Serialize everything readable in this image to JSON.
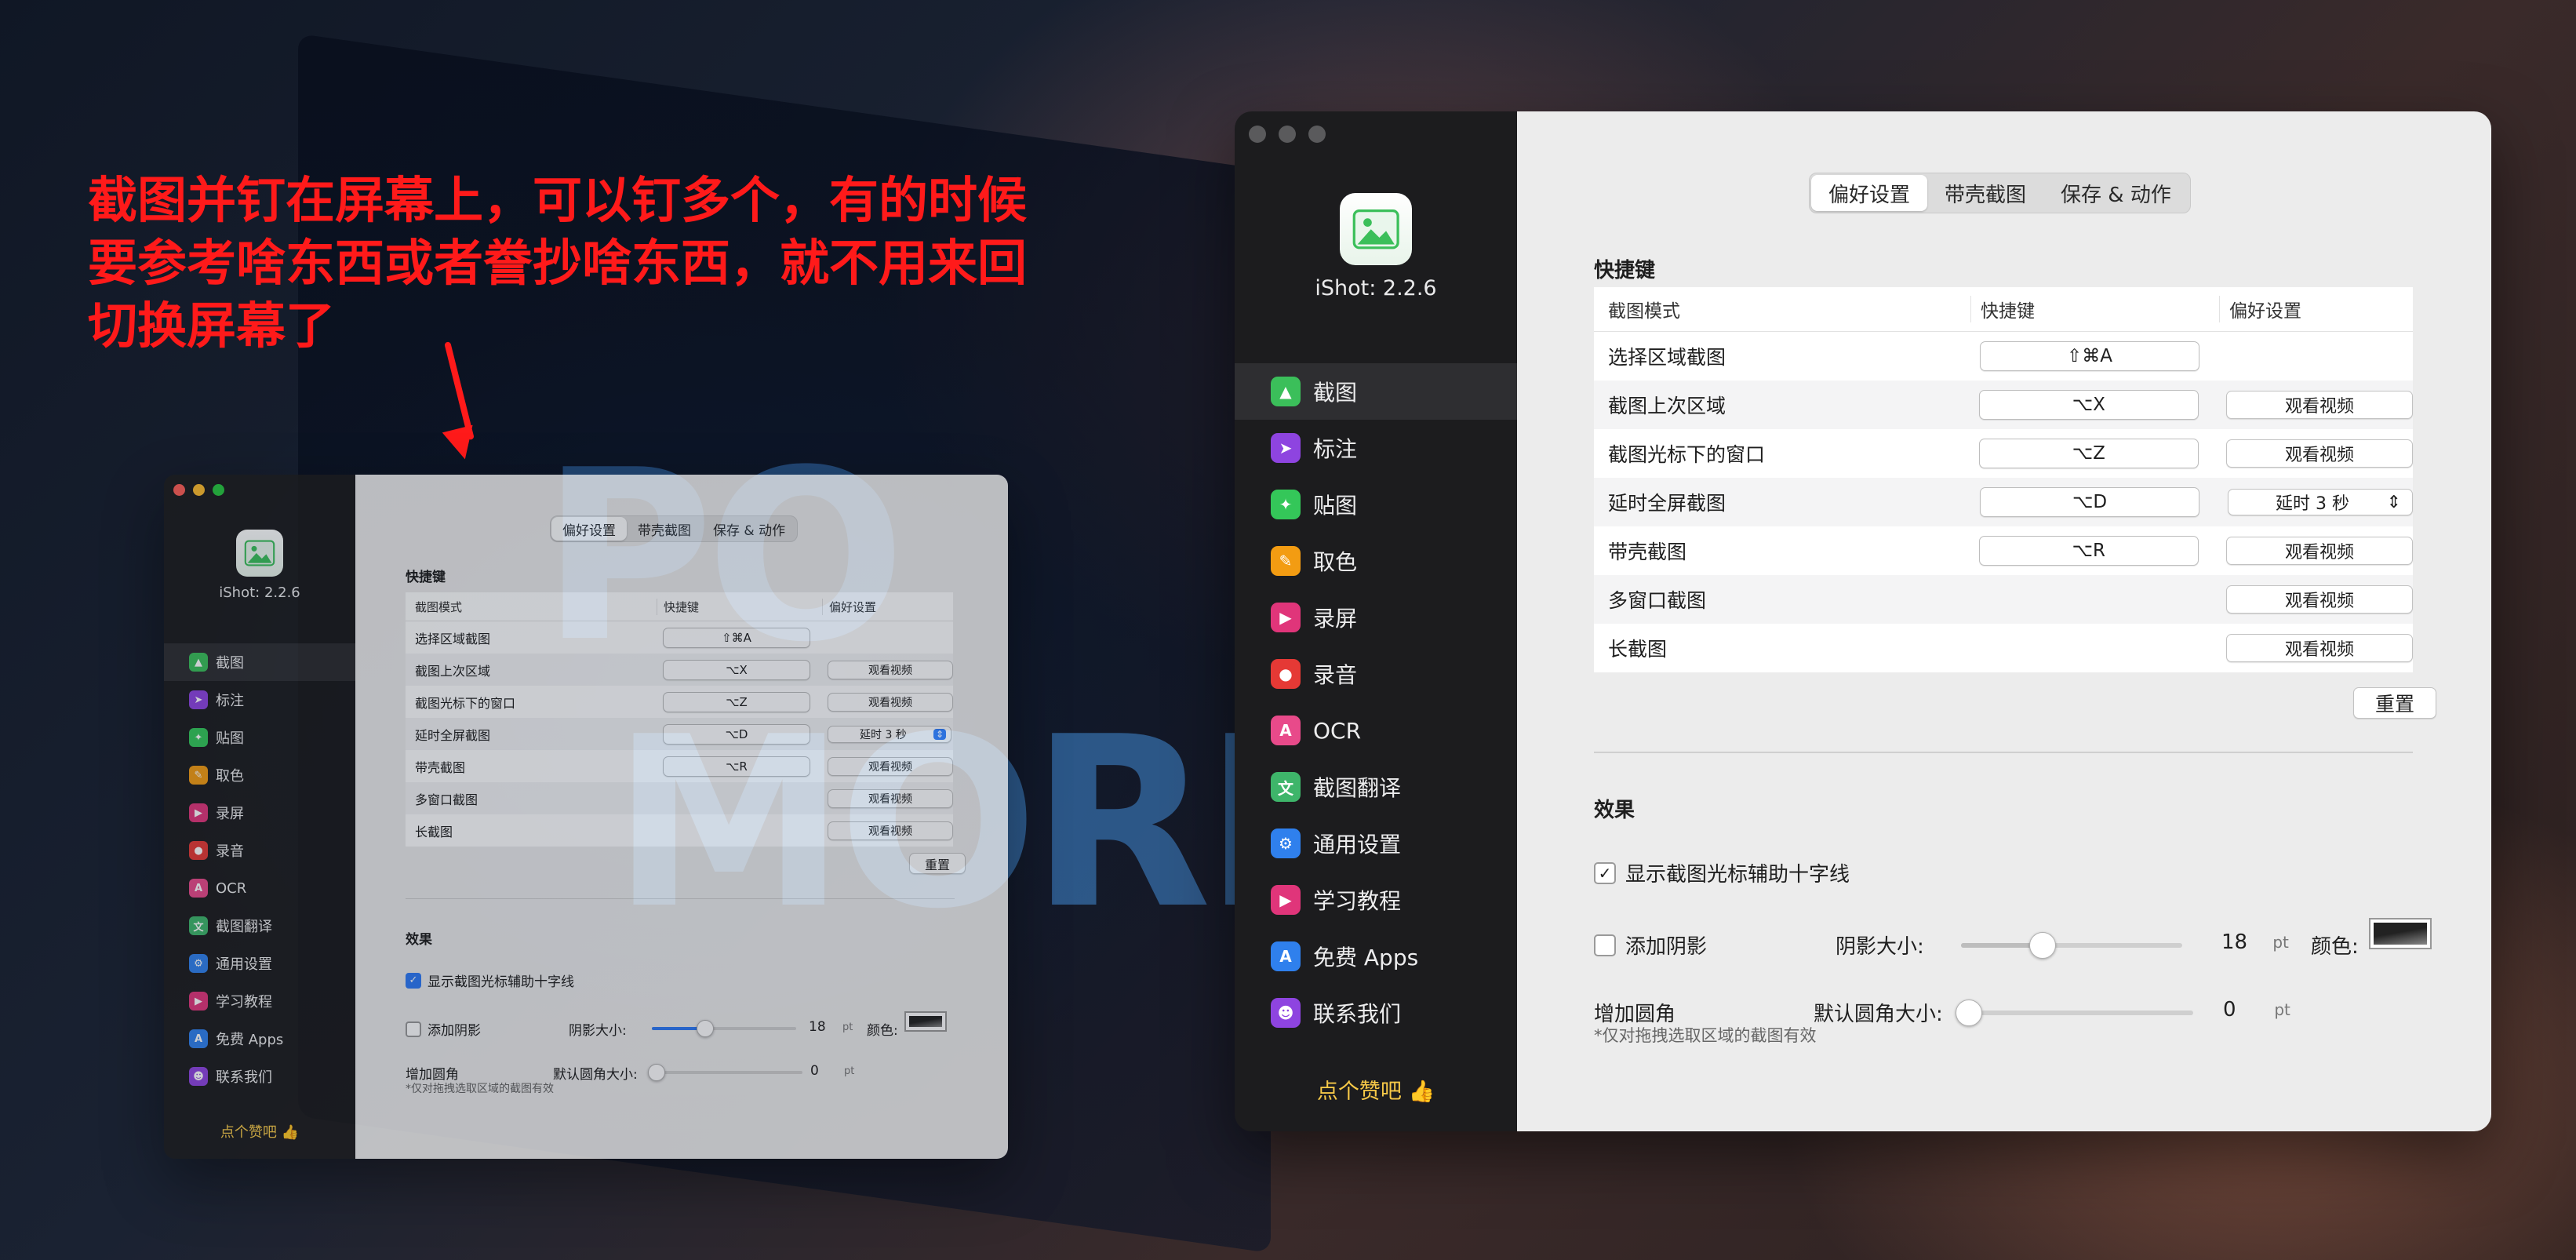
{
  "annotation": {
    "line1": " 截图并钉在屏幕上，可以钉多个，有的时候",
    "line2": "要参考啥东西或者誊抄啥东西，就不用来回",
    "line3": "切换屏幕了"
  },
  "background": {
    "word1": "PO",
    "word2": "MORE."
  },
  "app": {
    "name": "iShot: 2.2.6",
    "like": "点个赞吧 👍",
    "nav": [
      {
        "label": "截图",
        "icon": "image-icon",
        "glyph": "▲",
        "color": "#3bbf5a"
      },
      {
        "label": "标注",
        "icon": "cursor-icon",
        "glyph": "➤",
        "color": "#8e44e0"
      },
      {
        "label": "贴图",
        "icon": "pin-icon",
        "glyph": "✦",
        "color": "#34c759"
      },
      {
        "label": "取色",
        "icon": "eyedropper-icon",
        "glyph": "✎",
        "color": "#f39c12"
      },
      {
        "label": "录屏",
        "icon": "video-icon",
        "glyph": "▶",
        "color": "#e0357a"
      },
      {
        "label": "录音",
        "icon": "microphone-icon",
        "glyph": "●",
        "color": "#e53935"
      },
      {
        "label": "OCR",
        "icon": "ocr-icon",
        "glyph": "A",
        "color": "#e84a8a"
      },
      {
        "label": "截图翻译",
        "icon": "translate-icon",
        "glyph": "文",
        "color": "#3eb56a"
      },
      {
        "label": "通用设置",
        "icon": "gear-icon",
        "glyph": "⚙",
        "color": "#2f80ed"
      },
      {
        "label": "学习教程",
        "icon": "play-icon",
        "glyph": "▶",
        "color": "#e0357a"
      },
      {
        "label": "免费 Apps",
        "icon": "appstore-icon",
        "glyph": "A",
        "color": "#2f80ed"
      },
      {
        "label": "联系我们",
        "icon": "contacts-icon",
        "glyph": "☻",
        "color": "#8e44e0"
      }
    ],
    "tabs": [
      "偏好设置",
      "带壳截图",
      "保存 & 动作"
    ],
    "shortcuts": {
      "title": "快捷键",
      "headers": [
        "截图模式",
        "快捷键",
        "偏好设置"
      ],
      "rows": [
        {
          "mode": "选择区域截图",
          "key": "⇧⌘A",
          "pref": ""
        },
        {
          "mode": "截图上次区域",
          "key": "⌥X",
          "pref": "观看视频"
        },
        {
          "mode": "截图光标下的窗口",
          "key": "⌥Z",
          "pref": "观看视频"
        },
        {
          "mode": "延时全屏截图",
          "key": "⌥D",
          "pref": "延时 3 秒",
          "select": true
        },
        {
          "mode": "带壳截图",
          "key": "⌥R",
          "pref": "观看视频"
        },
        {
          "mode": "多窗口截图",
          "key": "",
          "pref": "观看视频"
        },
        {
          "mode": "长截图",
          "key": "",
          "pref": "观看视频"
        }
      ],
      "reset": "重置",
      "small_select": "延时 3 秒"
    },
    "effects": {
      "title": "效果",
      "crosshair": "显示截图光标辅助十字线",
      "shadow": "添加阴影",
      "shadow_size_label": "阴影大小:",
      "shadow_size_value": "18",
      "shadow_level_main": 0.37,
      "shadow_level_small": 0.37,
      "unit": "pt",
      "color_label": "颜色:",
      "round_corner": "增加圆角",
      "corner_size_label": "默认圆角大小:",
      "corner_size_value": "0",
      "corner_level": 0,
      "note": "*仅对拖拽选取区域的截图有效"
    }
  }
}
